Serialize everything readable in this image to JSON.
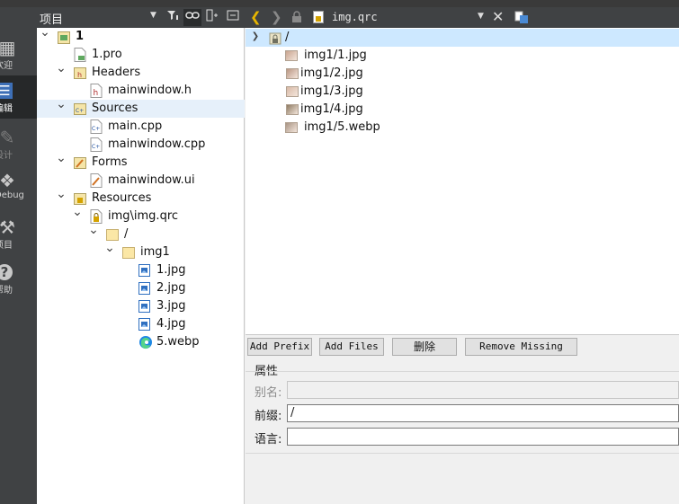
{
  "modebar": {
    "items": [
      {
        "label": "欢迎",
        "icon": "grid-icon",
        "state": "normal"
      },
      {
        "label": "编辑",
        "icon": "edit-icon",
        "state": "active"
      },
      {
        "label": "设计",
        "icon": "pencil-icon",
        "state": "dim"
      },
      {
        "label": "Debug",
        "icon": "bug-icon",
        "state": "normal"
      },
      {
        "label": "项目",
        "icon": "wrench-icon",
        "state": "normal"
      },
      {
        "label": "帮助",
        "icon": "help-icon",
        "state": "normal"
      }
    ]
  },
  "project_panel": {
    "title": "项目",
    "tree": [
      {
        "label": "1",
        "depth": 0,
        "expanded": true,
        "icon": "project-icon"
      },
      {
        "label": "1.pro",
        "depth": 1,
        "expanded": null,
        "icon": "pro-file-icon"
      },
      {
        "label": "Headers",
        "depth": 1,
        "expanded": true,
        "icon": "headers-folder-icon"
      },
      {
        "label": "mainwindow.h",
        "depth": 2,
        "expanded": null,
        "icon": "header-file-icon"
      },
      {
        "label": "Sources",
        "depth": 1,
        "expanded": true,
        "icon": "sources-folder-icon"
      },
      {
        "label": "main.cpp",
        "depth": 2,
        "expanded": null,
        "icon": "cpp-file-icon"
      },
      {
        "label": "mainwindow.cpp",
        "depth": 2,
        "expanded": null,
        "icon": "cpp-file-icon"
      },
      {
        "label": "Forms",
        "depth": 1,
        "expanded": true,
        "icon": "forms-folder-icon"
      },
      {
        "label": "mainwindow.ui",
        "depth": 2,
        "expanded": null,
        "icon": "ui-file-icon"
      },
      {
        "label": "Resources",
        "depth": 1,
        "expanded": true,
        "icon": "resources-folder-icon"
      },
      {
        "label": "img\\img.qrc",
        "depth": 2,
        "expanded": true,
        "icon": "qrc-file-icon"
      },
      {
        "label": "/",
        "depth": 3,
        "expanded": true,
        "icon": "folder-icon"
      },
      {
        "label": "img1",
        "depth": 4,
        "expanded": true,
        "icon": "folder-icon"
      },
      {
        "label": "1.jpg",
        "depth": 5,
        "expanded": null,
        "icon": "image-file-icon"
      },
      {
        "label": "2.jpg",
        "depth": 5,
        "expanded": null,
        "icon": "image-file-icon"
      },
      {
        "label": "3.jpg",
        "depth": 5,
        "expanded": null,
        "icon": "image-file-icon"
      },
      {
        "label": "4.jpg",
        "depth": 5,
        "expanded": null,
        "icon": "image-file-icon"
      },
      {
        "label": "5.webp",
        "depth": 5,
        "expanded": null,
        "icon": "edge-file-icon"
      }
    ],
    "highlighted_index": 4
  },
  "editor_toolbar": {
    "filename": "img.qrc"
  },
  "resource_tree": {
    "root": "/",
    "items": [
      {
        "label": "img1/1.jpg",
        "thumb_color": "#c9a48f"
      },
      {
        "label": "img1/2.jpg",
        "thumb_color": "#b99683"
      },
      {
        "label": "img1/3.jpg",
        "thumb_color": "#d8b9a6"
      },
      {
        "label": "img1/4.jpg",
        "thumb_color": "#8e7b63"
      },
      {
        "label": "img1/5.webp",
        "thumb_color": "#a89484"
      }
    ]
  },
  "buttons": {
    "add_prefix": "Add Prefix",
    "add_files": "Add Files",
    "remove": "删除",
    "remove_missing": "Remove Missing Files"
  },
  "properties": {
    "title": "属性",
    "alias_label": "别名:",
    "alias_value": "",
    "prefix_label": "前缀:",
    "prefix_value": "/",
    "language_label": "语言:",
    "language_value": ""
  },
  "colors": {
    "accent": "#e8b600",
    "selection": "#cde8ff",
    "dark_toolbar": "#404244"
  }
}
